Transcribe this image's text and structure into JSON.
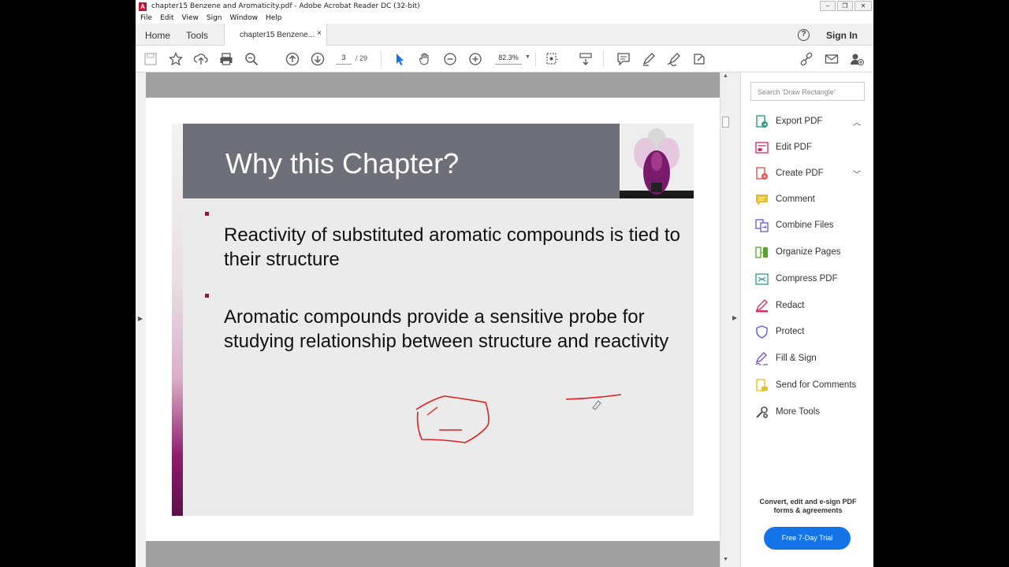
{
  "window": {
    "title": "chapter15 Benzene and Aromaticity.pdf - Adobe Acrobat Reader DC (32-bit)"
  },
  "menu": [
    "File",
    "Edit",
    "View",
    "Sign",
    "Window",
    "Help"
  ],
  "tabs": {
    "home": "Home",
    "tools": "Tools",
    "doc": "chapter15 Benzene...",
    "close": "×"
  },
  "header": {
    "help": "?",
    "signin": "Sign In"
  },
  "toolbar": {
    "page_current": "3",
    "page_total": "/ 29",
    "zoom": "82.3%"
  },
  "slide": {
    "title": "Why this Chapter?",
    "bullets": [
      "Reactivity of substituted aromatic compounds is tied to their structure",
      "Aromatic compounds provide a sensitive probe for studying relationship between structure and reactivity"
    ]
  },
  "pane": {
    "search_placeholder": "Search 'Draw Rectangle'",
    "tools": [
      {
        "label": "Export PDF",
        "icon": "export-pdf-icon",
        "color": "#2e9a8e"
      },
      {
        "label": "Edit PDF",
        "icon": "edit-pdf-icon",
        "color": "#d6336c"
      },
      {
        "label": "Create PDF",
        "icon": "create-pdf-icon",
        "color": "#e05454"
      },
      {
        "label": "Comment",
        "icon": "comment-icon",
        "color": "#e7c122"
      },
      {
        "label": "Combine Files",
        "icon": "combine-files-icon",
        "color": "#6a5acd"
      },
      {
        "label": "Organize Pages",
        "icon": "organize-pages-icon",
        "color": "#5aa02c"
      },
      {
        "label": "Compress PDF",
        "icon": "compress-pdf-icon",
        "color": "#2e9a8e"
      },
      {
        "label": "Redact",
        "icon": "redact-icon",
        "color": "#d6336c"
      },
      {
        "label": "Protect",
        "icon": "protect-icon",
        "color": "#5b5fc7"
      },
      {
        "label": "Fill & Sign",
        "icon": "fill-sign-icon",
        "color": "#7b4fc9"
      },
      {
        "label": "Send for Comments",
        "icon": "send-for-comments-icon",
        "color": "#e7c122"
      },
      {
        "label": "More Tools",
        "icon": "more-tools-icon",
        "color": "#555555"
      }
    ],
    "promo": "Convert, edit and e-sign PDF forms & agreements",
    "trial_button": "Free 7-Day Trial"
  },
  "colors": {
    "accent": "#1473e6",
    "slide_header": "#6e6f78",
    "annotation": "#e02020"
  }
}
